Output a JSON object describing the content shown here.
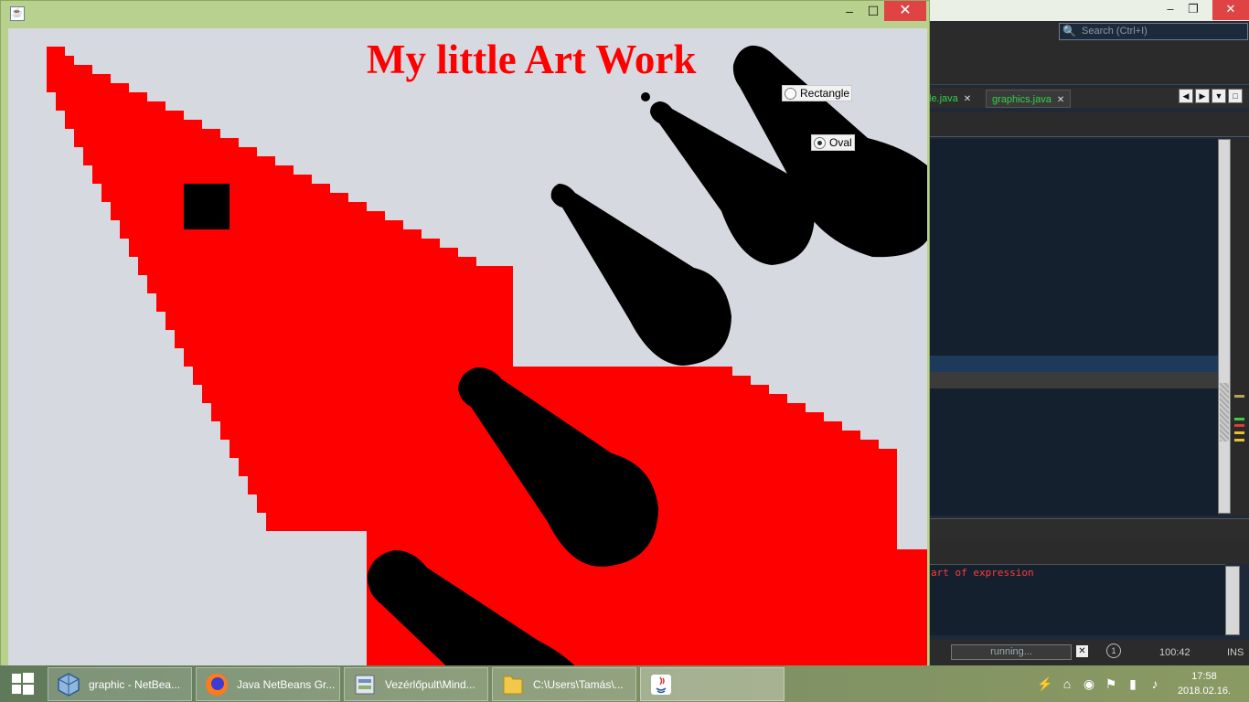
{
  "java_window": {
    "canvas_title": "My little Art Work",
    "radio_rectangle": "Rectangle",
    "radio_oval": "Oval",
    "selected_shape": "Oval",
    "colors": {
      "art_red": "#ff0000",
      "art_black": "#000000",
      "canvas_bg": "#d6d9e0"
    },
    "buttons": {
      "minimize": "–",
      "maximize": "☐",
      "close": "✕"
    }
  },
  "netbeans": {
    "search_placeholder": "Search (Ctrl+I)",
    "tabs": [
      {
        "label": "le.java"
      },
      {
        "label": "graphics.java"
      }
    ],
    "output_text": "art of expression",
    "status": {
      "running": "running...",
      "position": "100:42",
      "mode": "INS"
    }
  },
  "taskbar": {
    "items": [
      {
        "label": "graphic - NetBea...",
        "icon": "netbeans-icon"
      },
      {
        "label": "Java NetBeans Gr...",
        "icon": "firefox-icon"
      },
      {
        "label": "Vezérlőpult\\Mind...",
        "icon": "control-panel-icon"
      },
      {
        "label": "C:\\Users\\Tamás\\...",
        "icon": "folder-icon"
      },
      {
        "label": "",
        "icon": "java-icon"
      }
    ],
    "clock_time": "17:58",
    "clock_date": "2018.02.16."
  }
}
